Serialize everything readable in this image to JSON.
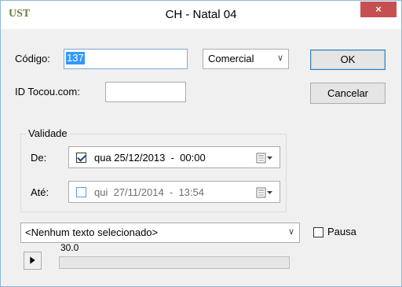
{
  "window": {
    "title": "CH - Natal 04",
    "app_icon_text": "UST",
    "close_label": "×"
  },
  "form": {
    "codigo_label": "Código:",
    "codigo_value": "137",
    "category_value": "Comercial",
    "id_label": "ID Tocou.com:",
    "id_value": ""
  },
  "buttons": {
    "ok": "OK",
    "cancel": "Cancelar"
  },
  "validity": {
    "title": "Validade",
    "from_label": "De:",
    "from_checked": true,
    "from_value": "qua 25/12/2013  -  00:00",
    "to_label": "Até:",
    "to_checked": false,
    "to_value": "qui  27/11/2014  -  13:54"
  },
  "text_select": {
    "value": "<Nenhum texto selecionado>"
  },
  "pause": {
    "label": "Pausa",
    "checked": false
  },
  "playback": {
    "duration": "30.0",
    "progress": 0
  },
  "colors": {
    "accent": "#3399ff",
    "close": "#c74f50"
  }
}
